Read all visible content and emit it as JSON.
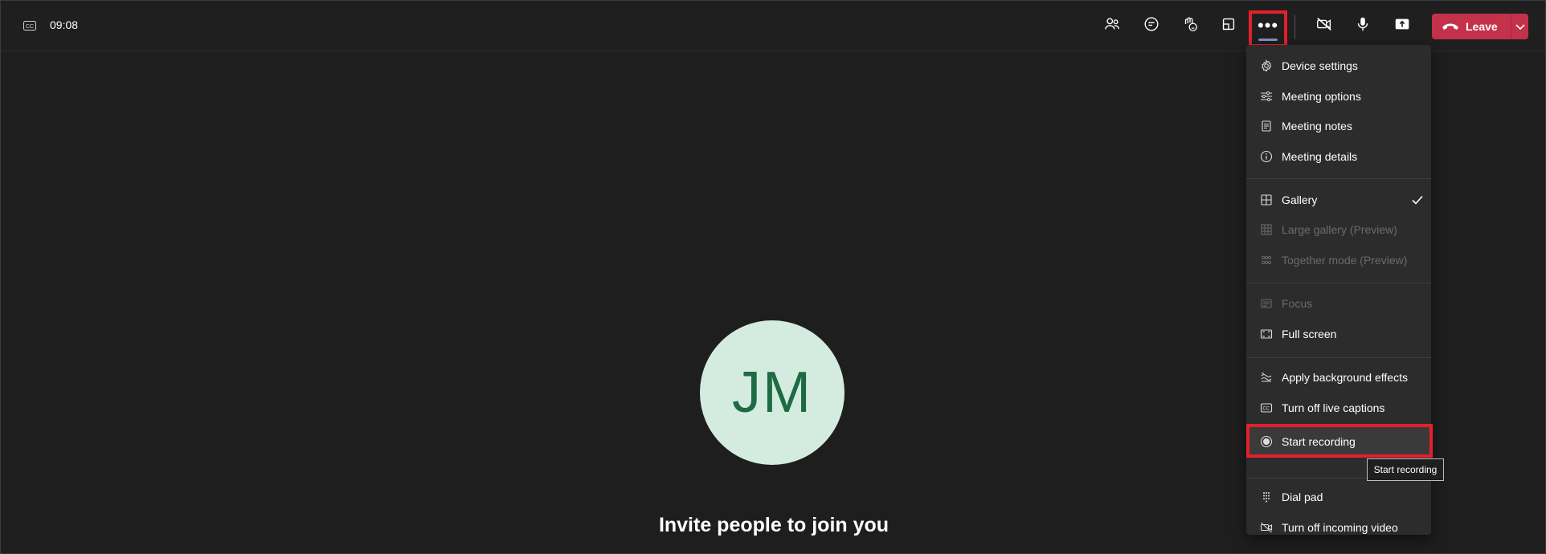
{
  "toolbar": {
    "timer": "09:08",
    "leave_label": "Leave",
    "icons": [
      "closed-captions-icon",
      "people-icon",
      "chat-icon",
      "reactions-icon",
      "share-tray-icon",
      "more-icon",
      "camera-off-icon",
      "microphone-icon",
      "share-icon",
      "phone-hangup-icon",
      "chevron-down-icon"
    ]
  },
  "stage": {
    "avatar_initials": "JM",
    "invite_text": "Invite people to join you"
  },
  "menu": {
    "items": [
      {
        "label": "Device settings",
        "icon": "gear-icon",
        "enabled": true
      },
      {
        "label": "Meeting options",
        "icon": "sliders-icon",
        "enabled": true
      },
      {
        "label": "Meeting notes",
        "icon": "notes-icon",
        "enabled": true
      },
      {
        "label": "Meeting details",
        "icon": "info-icon",
        "enabled": true
      },
      {
        "label": "Gallery",
        "icon": "grid-icon",
        "enabled": true,
        "checked": true
      },
      {
        "label": "Large gallery (Preview)",
        "icon": "large-grid-icon",
        "enabled": false
      },
      {
        "label": "Together mode (Preview)",
        "icon": "together-icon",
        "enabled": false
      },
      {
        "label": "Focus",
        "icon": "focus-icon",
        "enabled": false
      },
      {
        "label": "Full screen",
        "icon": "fullscreen-icon",
        "enabled": true
      },
      {
        "label": "Apply background effects",
        "icon": "background-icon",
        "enabled": true
      },
      {
        "label": "Turn off live captions",
        "icon": "captions-icon",
        "enabled": true
      },
      {
        "label": "Start recording",
        "icon": "record-icon",
        "enabled": true,
        "highlighted": true
      },
      {
        "label": "Dial pad",
        "icon": "dialpad-icon",
        "enabled": true
      },
      {
        "label": "Turn off incoming video",
        "icon": "video-off-icon",
        "enabled": true
      }
    ]
  },
  "tooltip": {
    "text": "Start recording"
  },
  "colors": {
    "leave": "#c4314b",
    "highlight_border": "#e3202b",
    "avatar_bg": "#d3ecdf",
    "avatar_text": "#1e6b43"
  }
}
